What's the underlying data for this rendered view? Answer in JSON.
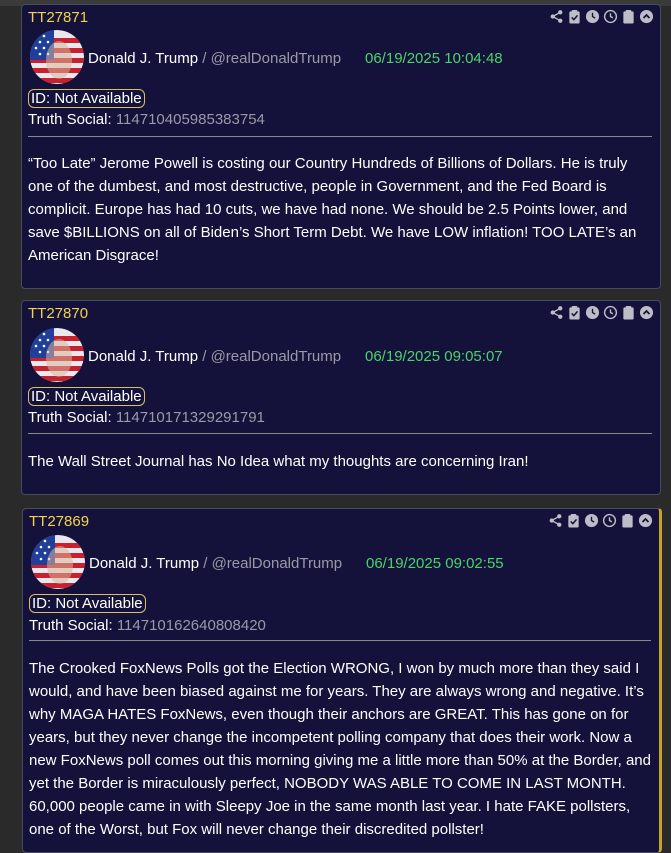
{
  "posts": [
    {
      "tt_id": "TT27871",
      "author": "Donald J. Trump",
      "separator": "/",
      "handle": "@realDonaldTrump",
      "timestamp": "06/19/2025 10:04:48",
      "id_line": "ID: Not Available",
      "truth_label": "Truth Social:",
      "truth_id": "114710405985383754",
      "text": "“Too Late” Jerome Powell is costing our Country Hundreds of Billions of Dollars. He is truly one of the dumbest, and most destructive, people in Government, and the Fed Board is complicit. Europe has had 10 cuts, we have had none. We should be 2.5 Points lower, and save $BILLIONS on all of Biden’s Short Term Debt. We have LOW inflation! TOO LATE’s an American Disgrace!"
    },
    {
      "tt_id": "TT27870",
      "author": "Donald J. Trump",
      "separator": "/",
      "handle": "@realDonaldTrump",
      "timestamp": "06/19/2025 09:05:07",
      "id_line": "ID: Not Available",
      "truth_label": "Truth Social:",
      "truth_id": "114710171329291791",
      "text": "The Wall Street Journal has No Idea what my thoughts are concerning Iran!"
    },
    {
      "tt_id": "TT27869",
      "author": "Donald J. Trump",
      "separator": "/",
      "handle": "@realDonaldTrump",
      "timestamp": "06/19/2025 09:02:55",
      "id_line": "ID: Not Available",
      "truth_label": "Truth Social:",
      "truth_id": "114710162640808420",
      "text": "The Crooked FoxNews Polls got the Election WRONG, I won by much more than they said I would, and have been biased against me for years. They are always wrong and negative. It’s why MAGA HATES FoxNews, even though their anchors are GREAT. This has gone on for years, but they never change the incompetent polling company that does their work. Now a new FoxNews poll comes out this morning giving me a little more than 50% at the Border, and yet the Border is miraculously perfect, NOBODY WAS ABLE TO COME IN LAST MONTH. 60,000 people came in with Sleepy Joe in the same month last year. I hate FAKE pollsters, one of the Worst, but Fox will never change their discredited pollster!"
    }
  ],
  "icon_names": [
    "share-icon",
    "clipboard-check-icon",
    "clock-icon",
    "history-icon",
    "clipboard-icon",
    "chevron-up-icon"
  ],
  "colors": {
    "card_bg": "#14123a",
    "tt_id": "#f3d44b",
    "timestamp": "#4cd26b",
    "muted": "#9a9aa6",
    "accent_border": "#c9a227"
  }
}
